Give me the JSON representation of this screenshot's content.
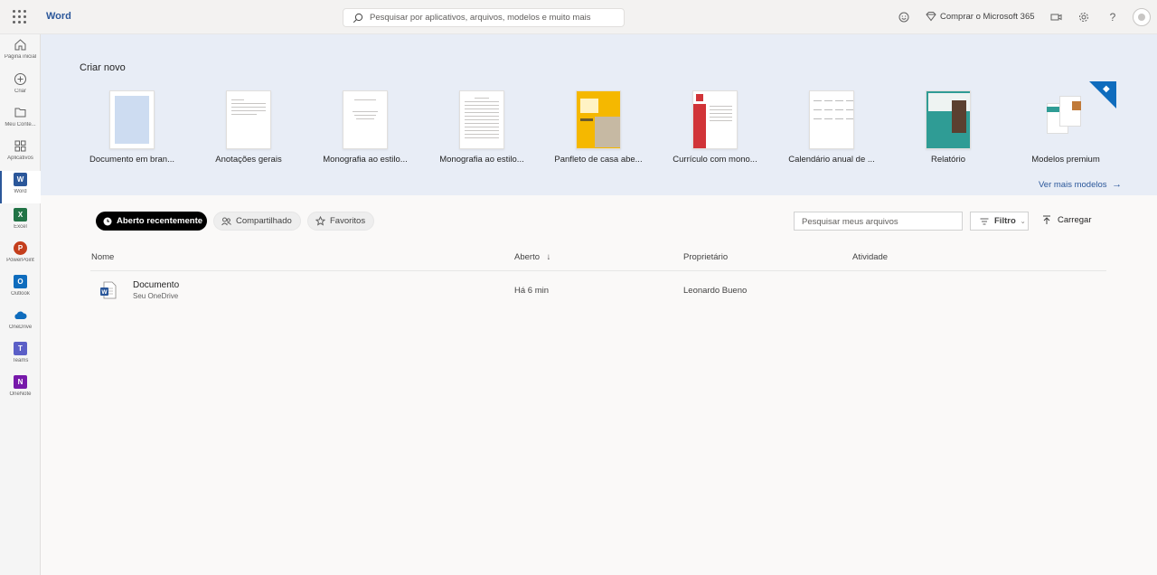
{
  "topbar": {
    "app_name": "Word",
    "search_placeholder": "Pesquisar por aplicativos, arquivos, modelos e muito mais",
    "buy_label": "Comprar o Microsoft 365"
  },
  "rail": {
    "items": [
      {
        "label": "Página inicial"
      },
      {
        "label": "Criar"
      },
      {
        "label": "Meu Conte..."
      },
      {
        "label": "Aplicativos"
      },
      {
        "label": "Word",
        "tile": "W",
        "color": "#2b579a"
      },
      {
        "label": "Excel",
        "tile": "X",
        "color": "#217346"
      },
      {
        "label": "PowerPoint",
        "tile": "P",
        "color": "#c43e1c"
      },
      {
        "label": "Outlook",
        "tile": "O",
        "color": "#0f6cbd"
      },
      {
        "label": "OneDrive"
      },
      {
        "label": "Teams",
        "tile": "T",
        "color": "#5b5fc7"
      },
      {
        "label": "OneNote",
        "tile": "N",
        "color": "#7719aa"
      }
    ]
  },
  "create": {
    "title": "Criar novo",
    "templates": [
      {
        "name": "Documento em bran..."
      },
      {
        "name": "Anotações gerais"
      },
      {
        "name": "Monografia ao estilo..."
      },
      {
        "name": "Monografia ao estilo..."
      },
      {
        "name": "Panfleto de casa abe..."
      },
      {
        "name": "Currículo com mono..."
      },
      {
        "name": "Calendário anual de ..."
      },
      {
        "name": "Relatório"
      },
      {
        "name": "Modelos premium"
      }
    ],
    "more_label": "Ver mais modelos"
  },
  "filters": {
    "recent": "Aberto recentemente",
    "shared": "Compartilhado",
    "favorites": "Favoritos",
    "search_placeholder": "Pesquisar meus arquivos",
    "filter_label": "Filtro",
    "upload_label": "Carregar"
  },
  "table": {
    "columns": [
      "Nome",
      "Aberto",
      "Proprietário",
      "Atividade"
    ],
    "rows": [
      {
        "name": "Documento",
        "location": "Seu OneDrive",
        "opened": "Há 6 min",
        "owner": "Leonardo Bueno"
      }
    ]
  },
  "colors": {
    "accent": "#2b579a",
    "create_band": "#e8edf6"
  }
}
